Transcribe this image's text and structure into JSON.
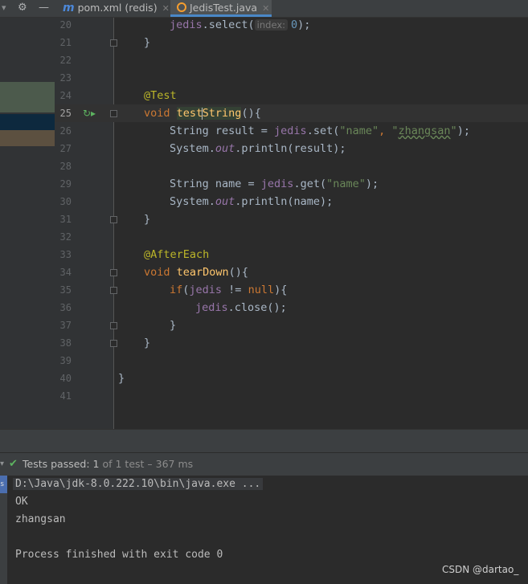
{
  "tabs": [
    {
      "icon": "m",
      "label": "pom.xml (redis)",
      "active": false
    },
    {
      "icon": "c",
      "label": "JedisTest.java",
      "active": true
    }
  ],
  "toolbar": {
    "gear_icon": "gear-icon",
    "minimize_icon": "minimize-icon"
  },
  "editor": {
    "current_line": 25,
    "lines": [
      {
        "n": "20"
      },
      {
        "n": "21"
      },
      {
        "n": "22"
      },
      {
        "n": "23"
      },
      {
        "n": "24"
      },
      {
        "n": "25"
      },
      {
        "n": "26"
      },
      {
        "n": "27"
      },
      {
        "n": "28"
      },
      {
        "n": "29"
      },
      {
        "n": "30"
      },
      {
        "n": "31"
      },
      {
        "n": "32"
      },
      {
        "n": "33"
      },
      {
        "n": "34"
      },
      {
        "n": "35"
      },
      {
        "n": "36"
      },
      {
        "n": "37"
      },
      {
        "n": "38"
      },
      {
        "n": "39"
      },
      {
        "n": "40"
      },
      {
        "n": "41"
      }
    ],
    "code": {
      "l20": {
        "obj": "jedis",
        "call": ".select(",
        "hint": "index:",
        "arg": "0",
        "end": ");"
      },
      "l21": "}",
      "l24": "@Test",
      "l25": {
        "kw": "void ",
        "fn_a": "test",
        "fn_b": "String",
        "rest": "(){"
      },
      "l26": {
        "a": "String result = ",
        "obj": "jedis",
        "b": ".set(",
        "s1": "\"name\"",
        "c": ", ",
        "s2a": "\"",
        "s2b": "zhangsan",
        "s2c": "\"",
        "d": ");"
      },
      "l27": {
        "a": "System.",
        "out": "out",
        "b": ".println(result);"
      },
      "l29": {
        "a": "String name = ",
        "obj": "jedis",
        "b": ".get(",
        "s1": "\"name\"",
        "c": ");"
      },
      "l30": {
        "a": "System.",
        "out": "out",
        "b": ".println(name);"
      },
      "l31": "}",
      "l33": "@AfterEach",
      "l34": {
        "kw": "void ",
        "fn": "tearDown",
        "rest": "(){"
      },
      "l35": {
        "kw": "if",
        "a": "(",
        "obj": "jedis",
        "b": " != ",
        "kw2": "null",
        "c": "){"
      },
      "l36": {
        "obj": "jedis",
        "a": ".close();"
      },
      "l37": "}",
      "l38": "}",
      "l40": "}"
    }
  },
  "test_status": {
    "label": "Tests passed:",
    "count": "1",
    "suffix": "of 1 test – 367 ms"
  },
  "console": {
    "command": "D:\\Java\\jdk-8.0.222.10\\bin\\java.exe ...",
    "lines": [
      "OK",
      "zhangsan",
      "",
      "Process finished with exit code 0"
    ]
  },
  "watermark": "CSDN @dartao_"
}
